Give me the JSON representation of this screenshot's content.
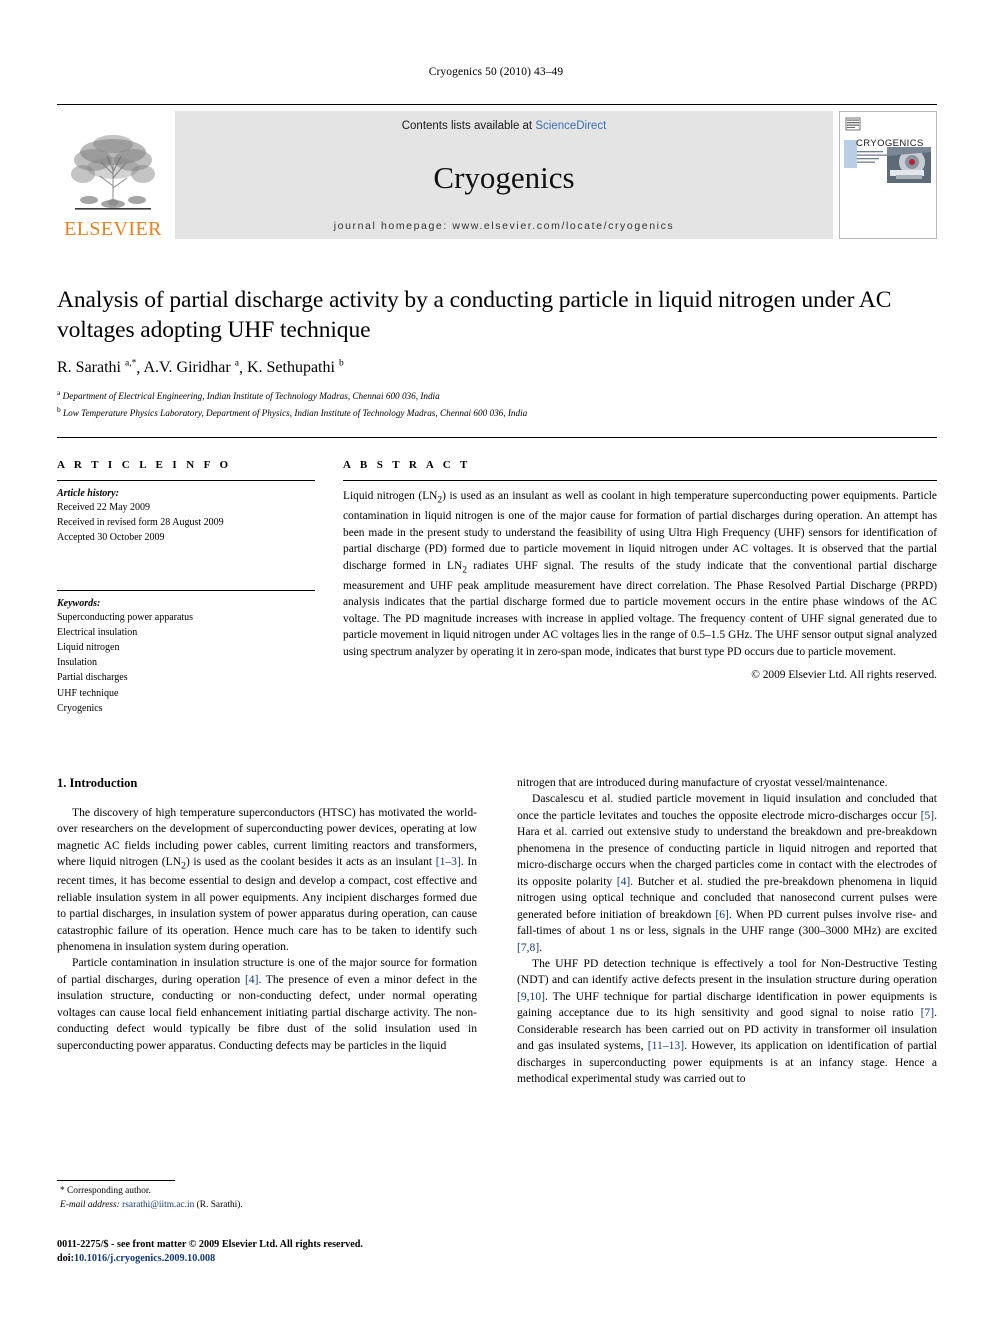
{
  "running_head": "Cryogenics 50 (2010) 43–49",
  "masthead": {
    "publisher": "ELSEVIER",
    "contents_prefix": "Contents lists available at ",
    "contents_link": "ScienceDirect",
    "journal_name": "Cryogenics",
    "homepage": "journal homepage: www.elsevier.com/locate/cryogenics",
    "cover_title": "CRYOGENICS"
  },
  "article": {
    "title": "Analysis of partial discharge activity by a conducting particle in liquid nitrogen under AC voltages adopting UHF technique",
    "authors": "R. Sarathi a,*, A.V. Giridhar a, K. Sethupathi b",
    "affiliation_a": "Department of Electrical Engineering, Indian Institute of Technology Madras, Chennai 600 036, India",
    "affiliation_b": "Low Temperature Physics Laboratory, Department of Physics, Indian Institute of Technology Madras, Chennai 600 036, India"
  },
  "article_info": {
    "heading": "A R T I C L E   I N F O",
    "history_label": "Article history:",
    "history": [
      "Received 22 May 2009",
      "Received in revised form 28 August 2009",
      "Accepted 30 October 2009"
    ],
    "keywords_label": "Keywords:",
    "keywords": [
      "Superconducting power apparatus",
      "Electrical insulation",
      "Liquid nitrogen",
      "Insulation",
      "Partial discharges",
      "UHF technique",
      "Cryogenics"
    ]
  },
  "abstract": {
    "heading": "A B S T R A C T",
    "text": "Liquid nitrogen (LN2) is used as an insulant as well as coolant in high temperature superconducting power equipments. Particle contamination in liquid nitrogen is one of the major cause for formation of partial discharges during operation. An attempt has been made in the present study to understand the feasibility of using Ultra High Frequency (UHF) sensors for identification of partial discharge (PD) formed due to particle movement in liquid nitrogen under AC voltages. It is observed that the partial discharge formed in LN2 radiates UHF signal. The results of the study indicate that the conventional partial discharge measurement and UHF peak amplitude measurement have direct correlation. The Phase Resolved Partial Discharge (PRPD) analysis indicates that the partial discharge formed due to particle movement occurs in the entire phase windows of the AC voltage. The PD magnitude increases with increase in applied voltage. The frequency content of UHF signal generated due to particle movement in liquid nitrogen under AC voltages lies in the range of 0.5–1.5 GHz. The UHF sensor output signal analyzed using spectrum analyzer by operating it in zero-span mode, indicates that burst type PD occurs due to particle movement.",
    "copyright": "© 2009 Elsevier Ltd. All rights reserved."
  },
  "introduction": {
    "section_title": "1. Introduction",
    "left_p1": "The discovery of high temperature superconductors (HTSC) has motivated the world-over researchers on the development of superconducting power devices, operating at low magnetic AC fields including power cables, current limiting reactors and transformers, where liquid nitrogen (LN2) is used as the coolant besides it acts as an insulant [1–3]. In recent times, it has become essential to design and develop a compact, cost effective and reliable insulation system in all power equipments. Any incipient discharges formed due to partial discharges, in insulation system of power apparatus during operation, can cause catastrophic failure of its operation. Hence much care has to be taken to identify such phenomena in insulation system during operation.",
    "left_p2": "Particle contamination in insulation structure is one of the major source for formation of partial discharges, during operation [4]. The presence of even a minor defect in the insulation structure, conducting or non-conducting defect, under normal operating voltages can cause local field enhancement initiating partial discharge activity. The non-conducting defect would typically be fibre dust of the solid insulation used in superconducting power apparatus. Conducting defects may be particles in the liquid",
    "right_p0": "nitrogen that are introduced during manufacture of cryostat vessel/maintenance.",
    "right_p1": "Dascalescu et al. studied particle movement in liquid insulation and concluded that once the particle levitates and touches the opposite electrode micro-discharges occur [5]. Hara et al. carried out extensive study to understand the breakdown and pre-breakdown phenomena in the presence of conducting particle in liquid nitrogen and reported that micro-discharge occurs when the charged particles come in contact with the electrodes of its opposite polarity [4]. Butcher et al. studied the pre-breakdown phenomena in liquid nitrogen using optical technique and concluded that nanosecond current pulses were generated before initiation of breakdown [6]. When PD current pulses involve rise- and fall-times of about 1 ns or less, signals in the UHF range (300–3000 MHz) are excited [7,8].",
    "right_p2": "The UHF PD detection technique is effectively a tool for Non-Destructive Testing (NDT) and can identify active defects present in the insulation structure during operation [9,10]. The UHF technique for partial discharge identification in power equipments is gaining acceptance due to its high sensitivity and good signal to noise ratio [7]. Considerable research has been carried out on PD activity in transformer oil insulation and gas insulated systems, [11–13]. However, its application on identification of partial discharges in superconducting power equipments is at an infancy stage. Hence a methodical experimental study was carried out to"
  },
  "footnotes": {
    "corresponding": "* Corresponding author.",
    "email_label": "E-mail address:",
    "email": "rsarathi@iitm.ac.in",
    "email_suffix": "(R. Sarathi).",
    "imprint": "0011-2275/$ - see front matter © 2009 Elsevier Ltd. All rights reserved.",
    "doi_label": "doi:",
    "doi": "10.1016/j.cryogenics.2009.10.008"
  },
  "colors": {
    "link_blue": "#3b6fb6",
    "ref_blue": "#13387e",
    "elsevier_orange": "#f07f1a",
    "masthead_gray": "#e4e4e4"
  }
}
